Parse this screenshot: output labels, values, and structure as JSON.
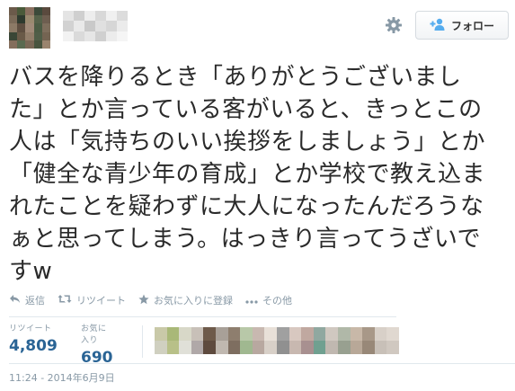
{
  "header": {
    "follow_label": "フォロー",
    "icons": {
      "gear": "gear-icon",
      "follow": "follow-person-plus-icon"
    },
    "accent": "#55acee"
  },
  "tweet": {
    "text": "バスを降りるとき「ありがとうございまし\nた」とか言っている客がいると、きっとこの\n人は「気持ちのいい挨拶をしましょう」とか\n「健全な青少年の育成」とか学校で教え込ま\nれたことを疑わずに大人になったんだろうな\nぁと思ってしまう。はっきり言ってうざいで\nすw"
  },
  "actions": [
    {
      "label": "返信",
      "icon": "reply-icon"
    },
    {
      "label": "リツイート",
      "icon": "retweet-icon"
    },
    {
      "label": "お気に入りに登録",
      "icon": "star-icon"
    },
    {
      "label": "その他",
      "icon": "more-icon"
    }
  ],
  "stats": {
    "retweets_label": "リツイート",
    "retweets_value": "4,809",
    "favorites_label": "お気に入り",
    "favorites_value": "690"
  },
  "timestamp": "11:24 - 2014年6月9日"
}
